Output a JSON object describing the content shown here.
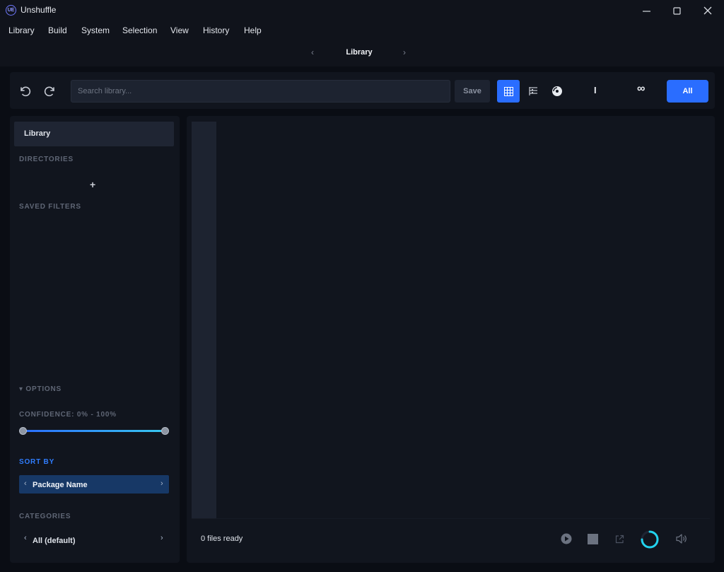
{
  "window": {
    "title": "Unshuffle",
    "logo_text": "UE"
  },
  "menu": [
    "Library",
    "Build",
    "System",
    "Selection",
    "View",
    "History",
    "Help"
  ],
  "nav": {
    "title": "Library",
    "prev_icon": "chevron-left-icon",
    "next_icon": "chevron-right-icon"
  },
  "toolbar": {
    "search_placeholder": "Search library...",
    "search_value": "",
    "save_label": "Save",
    "mode_single": "I",
    "mode_infinite": "∞",
    "all_label": "All",
    "icons": [
      "undo-icon",
      "redo-icon",
      "grid-view-icon",
      "tree-view-icon",
      "disc-icon"
    ]
  },
  "sidebar": {
    "active_item": "Library",
    "directories_label": "DIRECTORIES",
    "add_symbol": "+",
    "saved_filters_label": "SAVED FILTERS",
    "options_label": "▾ OPTIONS",
    "confidence_label": "CONFIDENCE: 0% - 100%",
    "confidence_range": [
      0,
      100
    ],
    "sort_by_label": "SORT BY",
    "sort_value": "Package Name",
    "categories_label": "CATEGORIES",
    "category_value": "All (default)"
  },
  "main": {
    "status": "0 files ready"
  },
  "colors": {
    "accent": "#2a6dff",
    "slider_end": "#38c8f0",
    "spinner": "#22d3ee",
    "panel": "#11151e",
    "background": "#0a0d14"
  }
}
